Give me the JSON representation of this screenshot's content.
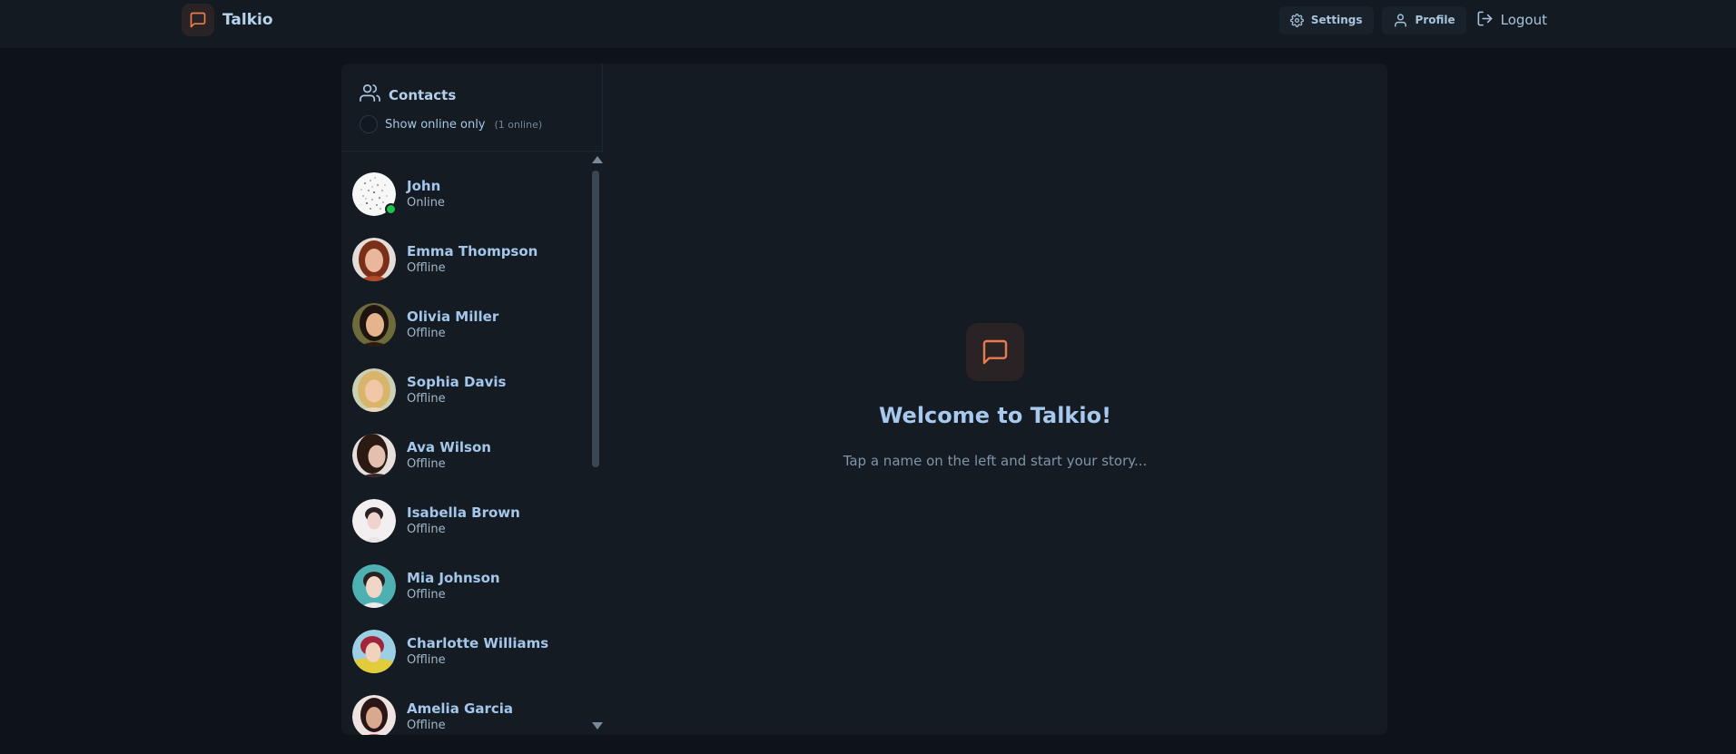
{
  "brand": {
    "name": "Talkio",
    "icon": "chat-bubble-icon",
    "accent": "#ea7b4c"
  },
  "nav": {
    "settings_label": "Settings",
    "profile_label": "Profile",
    "logout_label": "Logout"
  },
  "sidebar": {
    "title": "Contacts",
    "filter_label": "Show online only",
    "online_count": "(1 online)",
    "contacts": [
      {
        "name": "John",
        "status": "Online"
      },
      {
        "name": "Emma Thompson",
        "status": "Offline"
      },
      {
        "name": "Olivia Miller",
        "status": "Offline"
      },
      {
        "name": "Sophia Davis",
        "status": "Offline"
      },
      {
        "name": "Ava Wilson",
        "status": "Offline"
      },
      {
        "name": "Isabella Brown",
        "status": "Offline"
      },
      {
        "name": "Mia Johnson",
        "status": "Offline"
      },
      {
        "name": "Charlotte Williams",
        "status": "Offline"
      },
      {
        "name": "Amelia Garcia",
        "status": "Offline"
      }
    ]
  },
  "welcome": {
    "title": "Welcome to Talkio!",
    "subtitle": "Tap a name on the left and start your story..."
  }
}
